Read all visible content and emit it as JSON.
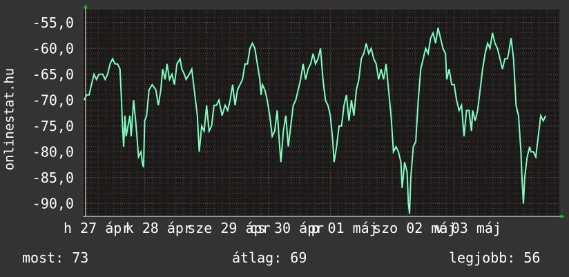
{
  "colors": {
    "background": "#333333",
    "plot": "#1a1a1a",
    "line": "#7fffbf",
    "grid": "#ffffff",
    "axis_arrow": "#00cc00"
  },
  "stats": {
    "most": "most: 73",
    "atlag": "átlag: 69",
    "legjobb": "legjobb: 56"
  },
  "chart_data": {
    "type": "line",
    "ylabel": "onlinestat.hu",
    "ylim": [
      -92.5,
      -52.5
    ],
    "yticks": [
      -55,
      -60,
      -65,
      -70,
      -75,
      -80,
      -85,
      -90
    ],
    "ytick_labels": [
      "-55,0",
      "-60,0",
      "-65,0",
      "-70,0",
      "-75,0",
      "-80,0",
      "-85,0",
      "-90,0"
    ],
    "xlim": [
      0,
      7.7
    ],
    "xtick_labels": [
      {
        "pos": 0.0,
        "text": "h 27 ápr"
      },
      {
        "pos": 1.0,
        "text": "k 28 ápr"
      },
      {
        "pos": 2.0,
        "text": "sze 29 ápr"
      },
      {
        "pos": 3.0,
        "text": "cs 30 ápr"
      },
      {
        "pos": 4.0,
        "text": "p 01 máj"
      },
      {
        "pos": 5.0,
        "text": "szo 02 máj"
      },
      {
        "pos": 6.0,
        "text": "v 03 máj"
      }
    ],
    "series": [
      {
        "values": [
          [
            0.02,
            -70
          ],
          [
            0.06,
            -69
          ],
          [
            0.1,
            -69
          ],
          [
            0.14,
            -67
          ],
          [
            0.18,
            -65
          ],
          [
            0.22,
            -66
          ],
          [
            0.26,
            -65
          ],
          [
            0.32,
            -65
          ],
          [
            0.36,
            -66
          ],
          [
            0.4,
            -65
          ],
          [
            0.44,
            -63
          ],
          [
            0.48,
            -62
          ],
          [
            0.52,
            -63
          ],
          [
            0.56,
            -63
          ],
          [
            0.6,
            -64
          ],
          [
            0.62,
            -69
          ],
          [
            0.64,
            -75
          ],
          [
            0.66,
            -79
          ],
          [
            0.68,
            -73
          ],
          [
            0.7,
            -77
          ],
          [
            0.73,
            -75
          ],
          [
            0.76,
            -73
          ],
          [
            0.78,
            -77
          ],
          [
            0.82,
            -70
          ],
          [
            0.86,
            -75
          ],
          [
            0.9,
            -81
          ],
          [
            0.94,
            -80
          ],
          [
            0.96,
            -82
          ],
          [
            0.98,
            -83
          ],
          [
            1.0,
            -74
          ],
          [
            1.03,
            -73
          ],
          [
            1.07,
            -68
          ],
          [
            1.12,
            -67
          ],
          [
            1.18,
            -68
          ],
          [
            1.22,
            -71
          ],
          [
            1.26,
            -68
          ],
          [
            1.29,
            -64
          ],
          [
            1.33,
            -66
          ],
          [
            1.36,
            -63
          ],
          [
            1.4,
            -66
          ],
          [
            1.44,
            -65
          ],
          [
            1.48,
            -67
          ],
          [
            1.52,
            -63
          ],
          [
            1.57,
            -62
          ],
          [
            1.6,
            -64
          ],
          [
            1.64,
            -65
          ],
          [
            1.67,
            -66
          ],
          [
            1.72,
            -65
          ],
          [
            1.76,
            -64
          ],
          [
            1.8,
            -68
          ],
          [
            1.85,
            -73
          ],
          [
            1.88,
            -80
          ],
          [
            1.92,
            -75
          ],
          [
            1.96,
            -76
          ],
          [
            2.0,
            -71
          ],
          [
            2.04,
            -76
          ],
          [
            2.08,
            -75
          ],
          [
            2.12,
            -71
          ],
          [
            2.16,
            -71
          ],
          [
            2.2,
            -70
          ],
          [
            2.25,
            -73
          ],
          [
            2.3,
            -71
          ],
          [
            2.34,
            -72
          ],
          [
            2.38,
            -70
          ],
          [
            2.42,
            -67
          ],
          [
            2.46,
            -71
          ],
          [
            2.5,
            -68
          ],
          [
            2.54,
            -67
          ],
          [
            2.58,
            -66
          ],
          [
            2.62,
            -63
          ],
          [
            2.66,
            -63
          ],
          [
            2.7,
            -60
          ],
          [
            2.74,
            -59
          ],
          [
            2.78,
            -60
          ],
          [
            2.82,
            -63
          ],
          [
            2.86,
            -66
          ],
          [
            2.88,
            -69
          ],
          [
            2.9,
            -67
          ],
          [
            2.94,
            -68
          ],
          [
            2.98,
            -70
          ],
          [
            3.02,
            -73
          ],
          [
            3.06,
            -77
          ],
          [
            3.1,
            -76
          ],
          [
            3.14,
            -72
          ],
          [
            3.18,
            -79
          ],
          [
            3.2,
            -82
          ],
          [
            3.24,
            -76
          ],
          [
            3.28,
            -73
          ],
          [
            3.32,
            -79
          ],
          [
            3.36,
            -75
          ],
          [
            3.4,
            -71
          ],
          [
            3.44,
            -70
          ],
          [
            3.48,
            -68
          ],
          [
            3.52,
            -66
          ],
          [
            3.56,
            -63
          ],
          [
            3.6,
            -66
          ],
          [
            3.64,
            -64
          ],
          [
            3.68,
            -63
          ],
          [
            3.72,
            -61
          ],
          [
            3.76,
            -63
          ],
          [
            3.8,
            -62
          ],
          [
            3.84,
            -60
          ],
          [
            3.88,
            -66
          ],
          [
            3.92,
            -70
          ],
          [
            3.96,
            -71
          ],
          [
            4.0,
            -73
          ],
          [
            4.04,
            -78
          ],
          [
            4.06,
            -82
          ],
          [
            4.1,
            -79
          ],
          [
            4.14,
            -75
          ],
          [
            4.18,
            -75
          ],
          [
            4.22,
            -71
          ],
          [
            4.26,
            -69
          ],
          [
            4.3,
            -74
          ],
          [
            4.34,
            -70
          ],
          [
            4.38,
            -73
          ],
          [
            4.42,
            -68
          ],
          [
            4.46,
            -66
          ],
          [
            4.5,
            -62
          ],
          [
            4.54,
            -61
          ],
          [
            4.58,
            -59
          ],
          [
            4.62,
            -61
          ],
          [
            4.66,
            -60
          ],
          [
            4.7,
            -62
          ],
          [
            4.74,
            -63
          ],
          [
            4.78,
            -66
          ],
          [
            4.82,
            -64
          ],
          [
            4.86,
            -66
          ],
          [
            4.9,
            -63
          ],
          [
            4.94,
            -68
          ],
          [
            4.98,
            -73
          ],
          [
            5.02,
            -80
          ],
          [
            5.06,
            -79
          ],
          [
            5.1,
            -80
          ],
          [
            5.14,
            -82
          ],
          [
            5.16,
            -87
          ],
          [
            5.2,
            -82
          ],
          [
            5.24,
            -84
          ],
          [
            5.26,
            -90
          ],
          [
            5.28,
            -92
          ],
          [
            5.3,
            -85
          ],
          [
            5.34,
            -79
          ],
          [
            5.38,
            -78
          ],
          [
            5.42,
            -70
          ],
          [
            5.46,
            -64
          ],
          [
            5.5,
            -62
          ],
          [
            5.54,
            -60
          ],
          [
            5.58,
            -61
          ],
          [
            5.62,
            -58
          ],
          [
            5.66,
            -57
          ],
          [
            5.7,
            -59
          ],
          [
            5.74,
            -56
          ],
          [
            5.78,
            -58
          ],
          [
            5.82,
            -60
          ],
          [
            5.86,
            -61
          ],
          [
            5.88,
            -66
          ],
          [
            5.92,
            -64
          ],
          [
            5.96,
            -67
          ],
          [
            6.0,
            -67
          ],
          [
            6.04,
            -70
          ],
          [
            6.08,
            -72
          ],
          [
            6.12,
            -71
          ],
          [
            6.16,
            -77
          ],
          [
            6.2,
            -72
          ],
          [
            6.24,
            -72
          ],
          [
            6.28,
            -76
          ],
          [
            6.3,
            -72
          ],
          [
            6.34,
            -74
          ],
          [
            6.38,
            -72
          ],
          [
            6.42,
            -68
          ],
          [
            6.46,
            -64
          ],
          [
            6.5,
            -61
          ],
          [
            6.54,
            -59
          ],
          [
            6.58,
            -60
          ],
          [
            6.62,
            -57
          ],
          [
            6.66,
            -59
          ],
          [
            6.7,
            -60
          ],
          [
            6.74,
            -62
          ],
          [
            6.78,
            -64
          ],
          [
            6.82,
            -62
          ],
          [
            6.86,
            -62
          ],
          [
            6.88,
            -61
          ],
          [
            6.92,
            -58
          ],
          [
            6.96,
            -62
          ],
          [
            7.0,
            -71
          ],
          [
            7.04,
            -73
          ],
          [
            7.08,
            -80
          ],
          [
            7.1,
            -86
          ],
          [
            7.12,
            -90
          ],
          [
            7.14,
            -85
          ],
          [
            7.18,
            -81
          ],
          [
            7.22,
            -79
          ],
          [
            7.24,
            -80
          ],
          [
            7.28,
            -80
          ],
          [
            7.32,
            -81
          ],
          [
            7.36,
            -77
          ],
          [
            7.4,
            -73
          ],
          [
            7.44,
            -74
          ],
          [
            7.48,
            -73
          ]
        ]
      }
    ]
  }
}
